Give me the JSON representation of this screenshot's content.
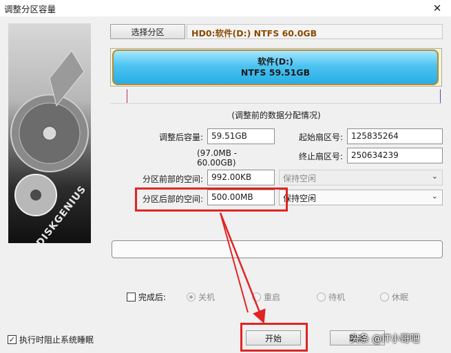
{
  "window": {
    "title": "调整分区容量",
    "close_glyph": "✕"
  },
  "side_image": {
    "brand": "DISKGENIUS"
  },
  "toolbar": {
    "select_partition_label": "选择分区",
    "disk_info": "HD0:软件(D:) NTFS 60.0GB"
  },
  "partition": {
    "name": "软件(D:)",
    "fs_size": "NTFS 59.51GB",
    "bar_color": "#3bbbee",
    "border_color": "#b6892b"
  },
  "caption": "(调整前的数据分配情况)",
  "form": {
    "size_after_label": "调整后容量:",
    "size_after_value": "59.51GB",
    "size_range": "(97.0MB - 60.00GB)",
    "start_sector_label": "起始扇区号:",
    "start_sector_value": "125835264",
    "end_sector_label": "终止扇区号:",
    "end_sector_value": "250634239",
    "space_before_label": "分区前部的空间:",
    "space_before_value": "992.00KB",
    "space_before_option": "保持空闲",
    "space_after_label": "分区后部的空间:",
    "space_after_value": "500.00MB",
    "space_after_option": "保持空闲"
  },
  "after_complete": {
    "label": "完成后:",
    "options": [
      "关机",
      "重启",
      "待机",
      "休眠"
    ]
  },
  "prevent_sleep_label": "执行时阻止系统睡眠",
  "buttons": {
    "start": "开始",
    "cancel": "取消"
  },
  "watermark": "头条 @IT小哥吧",
  "colors": {
    "annotation_red": "#e32222",
    "disk_info_text": "#8a4a00"
  }
}
